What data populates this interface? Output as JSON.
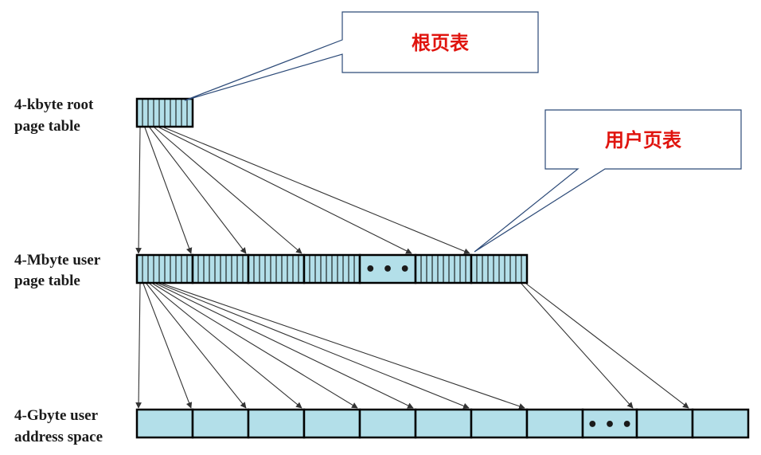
{
  "labels": {
    "root_line1": "4-kbyte root",
    "root_line2": "page table",
    "user_line1": "4-Mbyte user",
    "user_line2": "page table",
    "addr_line1": "4-Gbyte user",
    "addr_line2": "address space"
  },
  "callouts": {
    "root": "根页表",
    "user": "用户页表"
  },
  "ellipsis": "• • •",
  "colors": {
    "cell_fill": "#b3dfe9",
    "border": "#000000",
    "callout_border": "#2c4a78",
    "callout_text": "#e0140e",
    "arrow": "#333333"
  }
}
